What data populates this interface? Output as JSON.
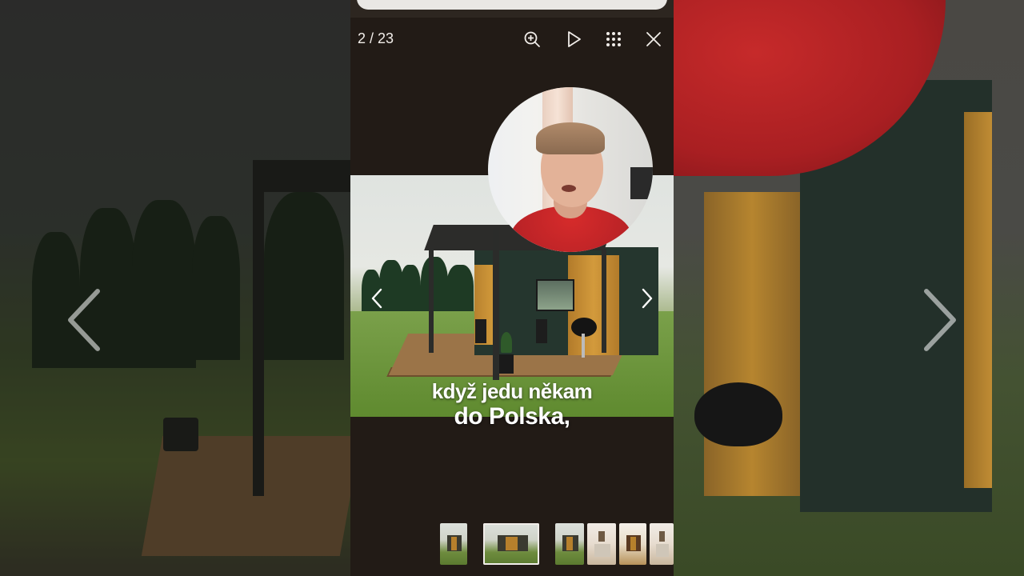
{
  "viewer": {
    "counter": "2 / 23",
    "toolbar": {
      "zoom": "zoom-in-icon",
      "play": "play-icon",
      "grid": "grid-icon",
      "close": "close-icon"
    },
    "caption_line1": "když jedu někam",
    "caption_line2": "do Polska,",
    "prev_icon": "chevron-left-icon",
    "next_icon": "chevron-right-icon"
  },
  "thumbnails": [
    {
      "kind": "cabin-front",
      "selected": false
    },
    {
      "kind": "cabin-deck",
      "selected": true
    },
    {
      "kind": "cabin-side",
      "selected": false
    },
    {
      "kind": "interior",
      "selected": false
    },
    {
      "kind": "interior-bright",
      "selected": false
    },
    {
      "kind": "interior",
      "selected": false
    }
  ],
  "colors": {
    "panel_bg": "#221b16",
    "text": "#f1ede9",
    "shirt_red": "#c62a2a"
  }
}
